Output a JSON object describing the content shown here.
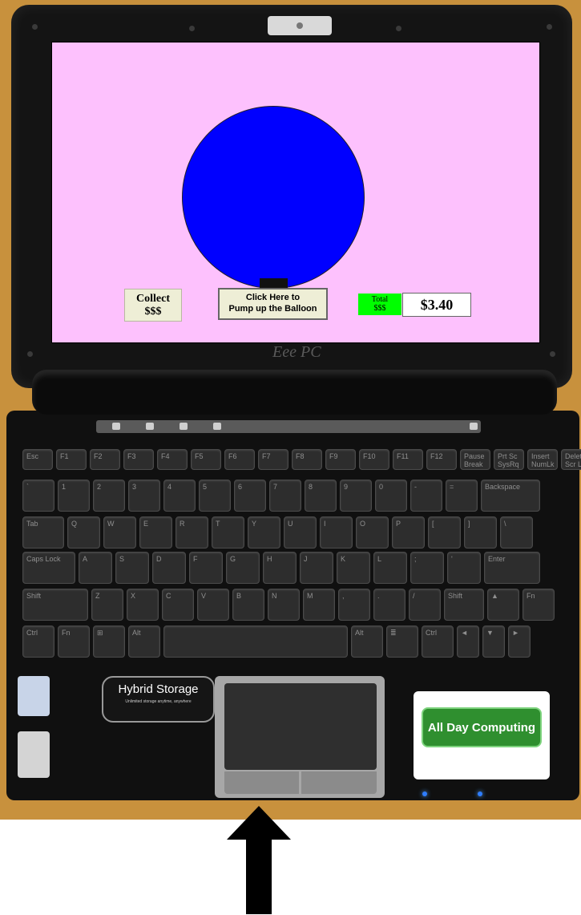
{
  "laptop": {
    "brand": "Eee PC",
    "hybrid_sticker": {
      "title": "Hybrid Storage",
      "subtitle": "Unlimited storage anytime, anywhere"
    },
    "all_day_sticker": {
      "title": "All Day Computing"
    }
  },
  "screen": {
    "background_color": "#fdc1fd",
    "balloon_color": "#0000ff",
    "collect_button": {
      "line1": "Collect",
      "line2": "$$$"
    },
    "pump_button": {
      "line1": "Click Here to",
      "line2": "Pump up the Balloon"
    },
    "total": {
      "label_line1": "Total",
      "label_line2": "$$$",
      "value": "$3.40",
      "label_color": "#00ff00"
    }
  },
  "keyboard": {
    "rows": [
      [
        "Esc",
        "F1",
        "F2",
        "F3",
        "F4",
        "F5",
        "F6",
        "F7",
        "F8",
        "F9",
        "F10",
        "F11",
        "F12",
        "Pause Break",
        "Prt Sc SysRq",
        "Insert NumLk",
        "Delete Scr Lk"
      ],
      [
        "`",
        "1",
        "2",
        "3",
        "4",
        "5",
        "6",
        "7",
        "8",
        "9",
        "0",
        "-",
        "=",
        "Backspace"
      ],
      [
        "Tab",
        "Q",
        "W",
        "E",
        "R",
        "T",
        "Y",
        "U",
        "I",
        "O",
        "P",
        "[",
        "]",
        "\\"
      ],
      [
        "Caps Lock",
        "A",
        "S",
        "D",
        "F",
        "G",
        "H",
        "J",
        "K",
        "L",
        ";",
        "'",
        "Enter"
      ],
      [
        "Shift",
        "Z",
        "X",
        "C",
        "V",
        "B",
        "N",
        "M",
        ",",
        ".",
        "/",
        "Shift",
        "▲",
        "Fn"
      ],
      [
        "Ctrl",
        "Fn",
        "⊞",
        "Alt",
        "",
        "Alt",
        "≣",
        "Ctrl",
        "◄",
        "▼",
        "►"
      ]
    ]
  },
  "icons": {
    "arrow": "up-arrow-icon",
    "balloon": "balloon-shape"
  }
}
